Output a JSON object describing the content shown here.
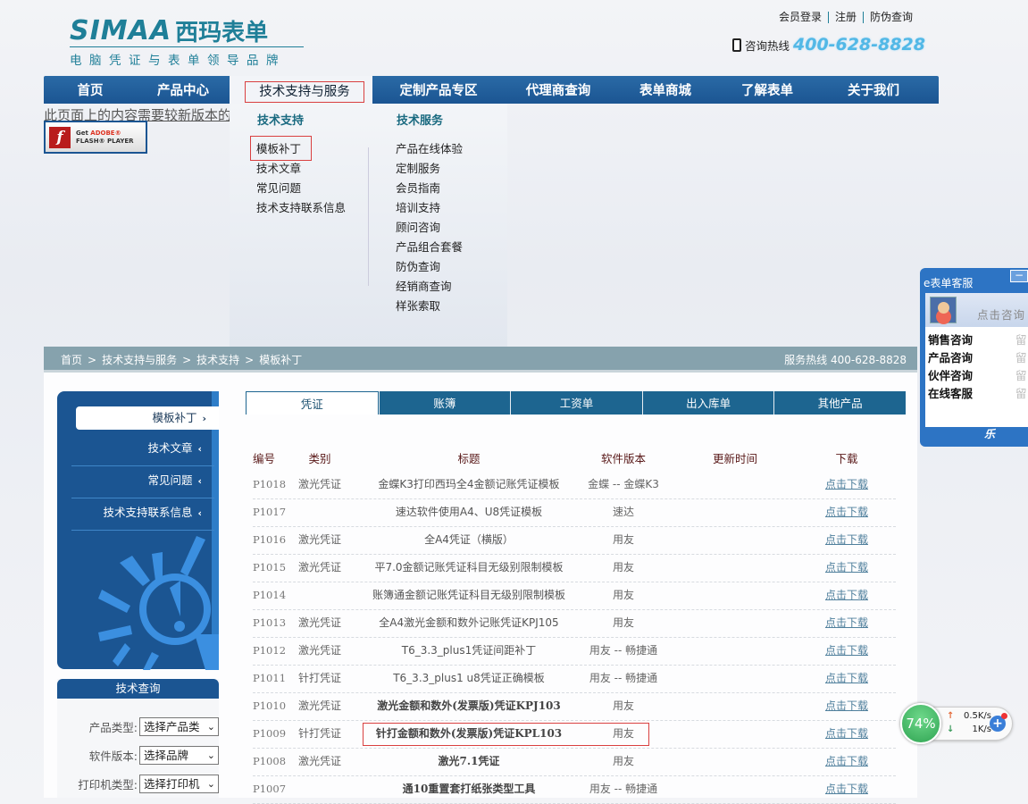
{
  "header": {
    "logo_latin": "SIMAA",
    "logo_cn": "西玛表单",
    "slogan": "电脑凭证与表单领导品牌",
    "top_links": [
      "会员登录",
      "注册",
      "防伪查询"
    ],
    "hotline_label": "咨询热线",
    "hotline_number": "400-628-8828"
  },
  "nav": {
    "items": [
      "首页",
      "产品中心",
      "技术支持与服务",
      "定制产品专区",
      "代理商查询",
      "表单商城",
      "了解表单",
      "关于我们"
    ],
    "active_index": 2
  },
  "flash": {
    "message": "此页面上的内容需要较新版本的 Adobe Flash Player。",
    "button_line1_get": "Get ",
    "button_line1_brand": "ADOBE®",
    "button_line2": "FLASH® PLAYER"
  },
  "dropdown": {
    "support_heading": "技术支持",
    "support_items": [
      "模板补丁",
      "技术文章",
      "常见问题",
      "技术支持联系信息"
    ],
    "service_heading": "技术服务",
    "service_items": [
      "产品在线体验",
      "定制服务",
      "会员指南",
      "培训支持",
      "顾问咨询",
      "产品组合套餐",
      "防伪查询",
      "经销商查询",
      "样张索取"
    ]
  },
  "breadcrumb": {
    "items": [
      "首页",
      "技术支持与服务",
      "技术支持",
      "模板补丁"
    ],
    "separator": ">",
    "service_hotline": "服务热线 400-628-8828"
  },
  "sidebar": {
    "items": [
      {
        "label": "模板补丁",
        "chevron": "›",
        "active": true
      },
      {
        "label": "技术文章",
        "chevron": "‹"
      },
      {
        "label": "常见问题",
        "chevron": "‹"
      },
      {
        "label": "技术支持联系信息",
        "chevron": "‹"
      }
    ]
  },
  "tech_query": {
    "title": "技术查询",
    "fields": [
      {
        "label": "产品类型:",
        "value": "选择产品类"
      },
      {
        "label": "软件版本:",
        "value": "选择品牌"
      },
      {
        "label": "打印机类型:",
        "value": "选择打印机"
      }
    ]
  },
  "tabs": [
    "凭证",
    "账簿",
    "工资单",
    "出入库单",
    "其他产品"
  ],
  "table": {
    "headers": [
      "编号",
      "类别",
      "标题",
      "软件版本",
      "更新时间",
      "下载"
    ],
    "rows": [
      {
        "no": "P1018",
        "cat": "激光凭证",
        "title": "金蝶K3打印西玛全4金额记账凭证模板",
        "ver": "金蝶 -- 金蝶K3",
        "time": "",
        "dl": "点击下载",
        "bold": false
      },
      {
        "no": "P1017",
        "cat": "",
        "title": "速达软件使用A4、U8凭证模板",
        "ver": "速达",
        "time": "",
        "dl": "点击下载",
        "bold": false
      },
      {
        "no": "P1016",
        "cat": "激光凭证",
        "title": "全A4凭证（横版）",
        "ver": "用友",
        "time": "",
        "dl": "点击下载",
        "bold": false
      },
      {
        "no": "P1015",
        "cat": "激光凭证",
        "title": "平7.0金额记账凭证科目无级别限制模板",
        "ver": "用友",
        "time": "",
        "dl": "点击下载",
        "bold": false
      },
      {
        "no": "P1014",
        "cat": "",
        "title": "账簿通金额记账凭证科目无级别限制模板",
        "ver": "用友",
        "time": "",
        "dl": "点击下载",
        "bold": false
      },
      {
        "no": "P1013",
        "cat": "激光凭证",
        "title": "全A4激光金额和数外记账凭证KPJ105",
        "ver": "用友",
        "time": "",
        "dl": "点击下载",
        "bold": false
      },
      {
        "no": "P1012",
        "cat": "激光凭证",
        "title": "T6_3.3_plus1凭证间距补丁",
        "ver": "用友 -- 畅捷通",
        "time": "",
        "dl": "点击下载",
        "bold": false
      },
      {
        "no": "P1011",
        "cat": "针打凭证",
        "title": "T6_3.3_plus1 u8凭证正确模板",
        "ver": "用友 -- 畅捷通",
        "time": "",
        "dl": "点击下载",
        "bold": false
      },
      {
        "no": "P1010",
        "cat": "激光凭证",
        "title": "激光金额和数外(发票版)凭证KPJ103",
        "ver": "用友",
        "time": "",
        "dl": "点击下载",
        "bold": true
      },
      {
        "no": "P1009",
        "cat": "针打凭证",
        "title": "针打金额和数外(发票版)凭证KPL103",
        "ver": "用友",
        "time": "",
        "dl": "点击下载",
        "bold": true
      },
      {
        "no": "P1008",
        "cat": "激光凭证",
        "title": "激光7.1凭证",
        "ver": "用友",
        "time": "",
        "dl": "点击下载",
        "bold": true
      },
      {
        "no": "P1007",
        "cat": "",
        "title": "通10重置套打纸张类型工具",
        "ver": "用友 -- 畅捷通",
        "time": "",
        "dl": "点击下载",
        "bold": true
      }
    ]
  },
  "kefu": {
    "title": "e表单客服",
    "minimize": "−",
    "consult": "点击咨询",
    "lines": [
      {
        "label": "销售咨询",
        "action": "留"
      },
      {
        "label": "产品咨询",
        "action": "留"
      },
      {
        "label": "伙伴咨询",
        "action": "留"
      },
      {
        "label": "在线客服",
        "action": "留"
      }
    ],
    "footer": "Looyu乐"
  },
  "speed_widget": {
    "percent": "74%",
    "upload": "0.5K/s",
    "download": "1K/s"
  }
}
